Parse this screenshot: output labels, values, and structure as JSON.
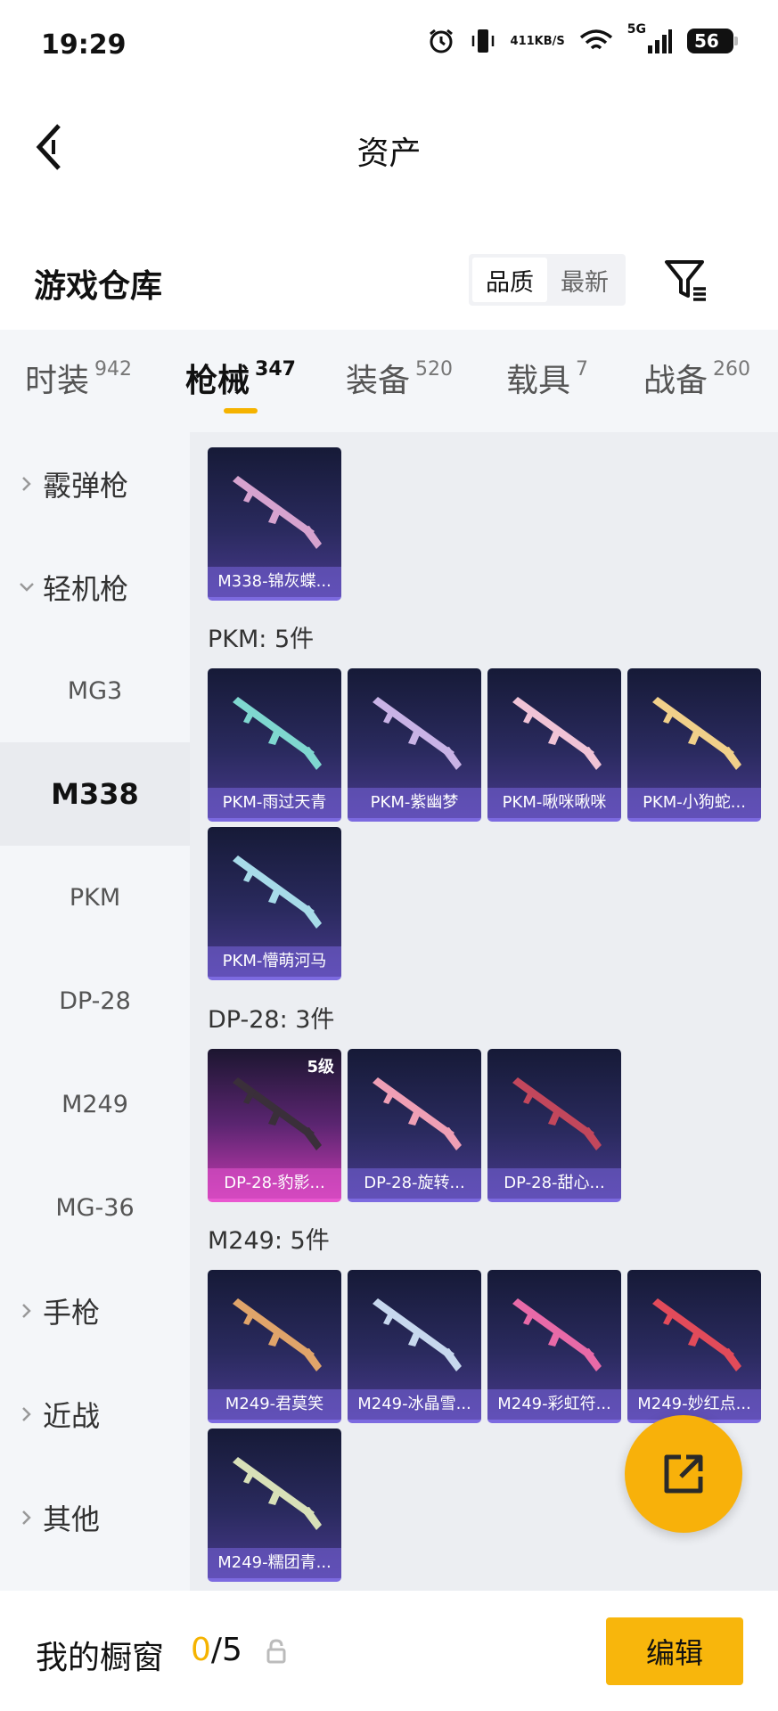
{
  "status_bar": {
    "time": "19:29",
    "net_speed_value": "411",
    "net_speed_unit": "KB/S",
    "network_type": "5G",
    "battery": "56"
  },
  "header": {
    "title": "资产"
  },
  "warehouse": {
    "title": "游戏仓库",
    "sort_options": [
      "品质",
      "最新"
    ],
    "sort_selected": "品质"
  },
  "tabs": [
    {
      "label": "时装",
      "count": "942"
    },
    {
      "label": "枪械",
      "count": "347",
      "active": true
    },
    {
      "label": "装备",
      "count": "520"
    },
    {
      "label": "载具",
      "count": "7"
    },
    {
      "label": "战备",
      "count": "260"
    }
  ],
  "sidebar": {
    "groups": [
      {
        "label": "霰弹枪",
        "expanded": false
      },
      {
        "label": "轻机枪",
        "expanded": true
      },
      {
        "label": "手枪",
        "expanded": false
      },
      {
        "label": "近战",
        "expanded": false
      },
      {
        "label": "其他",
        "expanded": false
      }
    ],
    "sub_items": [
      "MG3",
      "M338",
      "PKM",
      "DP-28",
      "M249",
      "MG-36"
    ],
    "active_sub": "M338"
  },
  "content": {
    "groups": [
      {
        "label": "",
        "items": [
          {
            "name": "M338-锦灰蝶...",
            "color": "#d6a3cf"
          }
        ]
      },
      {
        "label": "PKM: 5件",
        "items": [
          {
            "name": "PKM-雨过天青",
            "color": "#7fd7d0"
          },
          {
            "name": "PKM-紫幽梦",
            "color": "#c9b3e6"
          },
          {
            "name": "PKM-啾咪啾咪",
            "color": "#f0c3d6"
          },
          {
            "name": "PKM-小狗蛇...",
            "color": "#f1d08a"
          },
          {
            "name": "PKM-懵萌河马",
            "color": "#a7dbe9"
          }
        ]
      },
      {
        "label": "DP-28: 3件",
        "items": [
          {
            "name": "DP-28-豹影...",
            "color": "#3a2f3a",
            "level": "5级"
          },
          {
            "name": "DP-28-旋转...",
            "color": "#ef9fb5"
          },
          {
            "name": "DP-28-甜心...",
            "color": "#c2475c"
          }
        ]
      },
      {
        "label": "M249: 5件",
        "items": [
          {
            "name": "M249-君莫笑",
            "color": "#e0a46a"
          },
          {
            "name": "M249-冰晶雪...",
            "color": "#c7d8ee"
          },
          {
            "name": "M249-彩虹符...",
            "color": "#e86aa8"
          },
          {
            "name": "M249-妙红点...",
            "color": "#e24b5a"
          },
          {
            "name": "M249-糯团青...",
            "color": "#d8e0b8"
          }
        ]
      }
    ]
  },
  "bottom": {
    "showcase_label": "我的橱窗",
    "showcase_current": "0",
    "showcase_sep": "/",
    "showcase_total": "5",
    "edit_label": "编辑"
  },
  "colors": {
    "accent": "#f5b300",
    "card_dark": "#1c2040",
    "card_rarity": "#7c6ae0",
    "card_pink": "#e957d0"
  }
}
